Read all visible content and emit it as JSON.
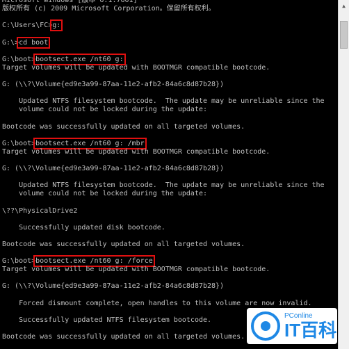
{
  "console": {
    "lines": [
      "Microsoft Windows [版本 6.1.7601]",
      "版权所有 (c) 2009 Microsoft Corporation。保留所有权利。",
      "",
      "C:\\Users\\FC>g:",
      "",
      "G:\\>cd boot",
      "",
      "G:\\boot>bootsect.exe /nt60 g:",
      "Target volumes will be updated with BOOTMGR compatible bootcode.",
      "",
      "G: (\\\\?\\Volume{ed9e3a99-87aa-11e2-afb2-84a6c8d87b28})",
      "",
      "    Updated NTFS filesystem bootcode.  The update may be unreliable since the",
      "    volume could not be locked during the update:",
      "",
      "Bootcode was successfully updated on all targeted volumes.",
      "",
      "G:\\boot>bootsect.exe /nt60 g: /mbr",
      "Target volumes will be updated with BOOTMGR compatible bootcode.",
      "",
      "G: (\\\\?\\Volume{ed9e3a99-87aa-11e2-afb2-84a6c8d87b28})",
      "",
      "    Updated NTFS filesystem bootcode.  The update may be unreliable since the",
      "    volume could not be locked during the update:",
      "",
      "\\??\\PhysicalDrive2",
      "",
      "    Successfully updated disk bootcode.",
      "",
      "Bootcode was successfully updated on all targeted volumes.",
      "",
      "G:\\boot>bootsect.exe /nt60 g: /force",
      "Target volumes will be updated with BOOTMGR compatible bootcode.",
      "",
      "G: (\\\\?\\Volume{ed9e3a99-87aa-11e2-afb2-84a6c8d87b28})",
      "",
      "    Forced dismount complete, open handles to this volume are now invalid.",
      "",
      "    Successfully updated NTFS filesystem bootcode.",
      "",
      "Bootcode was successfully updated on all targeted volumes."
    ],
    "highlights": [
      {
        "line": 3,
        "prefix": "C:\\Users\\FC>",
        "text": "g:"
      },
      {
        "line": 5,
        "prefix": "G:\\>",
        "text": "cd boot"
      },
      {
        "line": 7,
        "prefix": "G:\\boot>",
        "text": "bootsect.exe /nt60 g:"
      },
      {
        "line": 17,
        "prefix": "G:\\boot>",
        "text": "bootsect.exe /nt60 g: /mbr"
      },
      {
        "line": 31,
        "prefix": "G:\\boot>",
        "text": "bootsect.exe /nt60 g: /force"
      }
    ],
    "highlight_color": "#e01010"
  },
  "scrollbar": {
    "up_icon": "triangle-up-icon"
  },
  "watermark": {
    "brand": "PConline",
    "title": "IT百科",
    "color": "#1e88e5"
  }
}
